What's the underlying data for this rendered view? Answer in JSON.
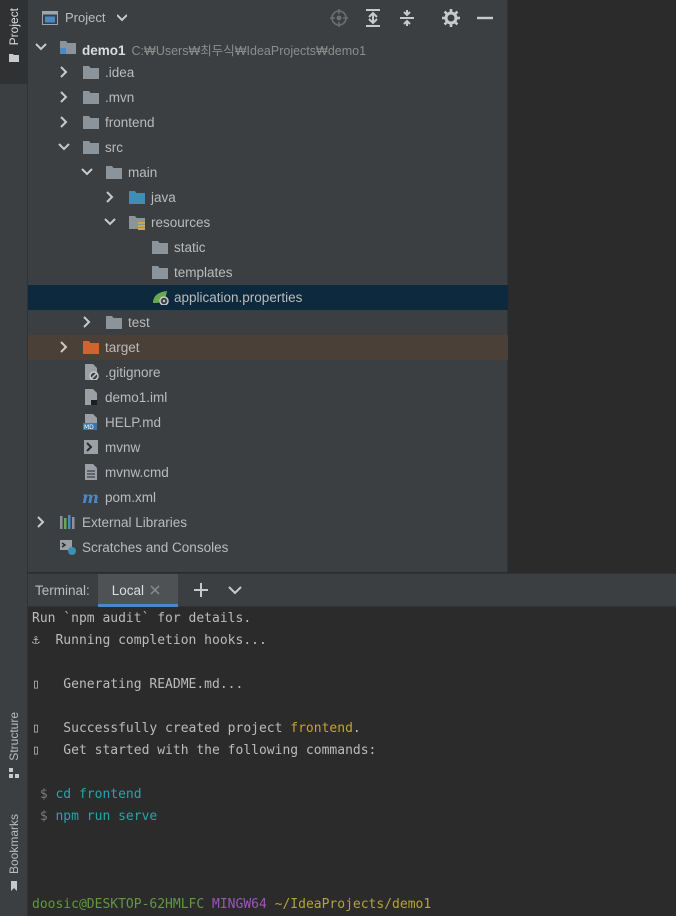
{
  "left_stripe": {
    "project_label": "Project",
    "structure_label": "Structure",
    "bookmarks_label": "Bookmarks"
  },
  "project_panel": {
    "title": "Project",
    "tools": [
      "locate-icon",
      "expand-all-icon",
      "collapse-all-icon",
      "gear-icon",
      "hide-icon"
    ],
    "tree": [
      {
        "label": "demo1",
        "path": "C:₩Users₩최두식₩IdeaProjects₩demo1",
        "depth": 0,
        "arrow": "down",
        "icon": "module-folder",
        "bold": true
      },
      {
        "label": ".idea",
        "depth": 1,
        "arrow": "right",
        "icon": "folder"
      },
      {
        "label": ".mvn",
        "depth": 1,
        "arrow": "right",
        "icon": "folder"
      },
      {
        "label": "frontend",
        "depth": 1,
        "arrow": "right",
        "icon": "folder"
      },
      {
        "label": "src",
        "depth": 1,
        "arrow": "down",
        "icon": "folder"
      },
      {
        "label": "main",
        "depth": 2,
        "arrow": "down",
        "icon": "folder"
      },
      {
        "label": "java",
        "depth": 3,
        "arrow": "right",
        "icon": "source-folder"
      },
      {
        "label": "resources",
        "depth": 3,
        "arrow": "down",
        "icon": "resources-folder"
      },
      {
        "label": "static",
        "depth": 4,
        "arrow": "none",
        "icon": "folder"
      },
      {
        "label": "templates",
        "depth": 4,
        "arrow": "none",
        "icon": "folder"
      },
      {
        "label": "application.properties",
        "depth": 4,
        "arrow": "none",
        "icon": "spring-properties",
        "selected": true
      },
      {
        "label": "test",
        "depth": 2,
        "arrow": "right",
        "icon": "folder"
      },
      {
        "label": "target",
        "depth": 1,
        "arrow": "right",
        "icon": "excluded-folder",
        "excluded": true
      },
      {
        "label": ".gitignore",
        "depth": 1,
        "arrow": "none",
        "icon": "ignore-file"
      },
      {
        "label": "demo1.iml",
        "depth": 1,
        "arrow": "none",
        "icon": "iml-file"
      },
      {
        "label": "HELP.md",
        "depth": 1,
        "arrow": "none",
        "icon": "md-file"
      },
      {
        "label": "mvnw",
        "depth": 1,
        "arrow": "none",
        "icon": "shell-file"
      },
      {
        "label": "mvnw.cmd",
        "depth": 1,
        "arrow": "none",
        "icon": "text-file"
      },
      {
        "label": "pom.xml",
        "depth": 1,
        "arrow": "none",
        "icon": "maven-file"
      },
      {
        "label": "External Libraries",
        "depth": 0,
        "arrow": "right",
        "icon": "libraries"
      },
      {
        "label": "Scratches and Consoles",
        "depth": 0,
        "arrow": "none",
        "icon": "scratches"
      }
    ]
  },
  "terminal": {
    "title": "Terminal:",
    "tab_label": "Local",
    "lines": [
      {
        "segments": [
          {
            "text": "Run `npm audit` for details.",
            "cls": ""
          }
        ]
      },
      {
        "segments": [
          {
            "text": "⚓  Running completion hooks...",
            "cls": ""
          }
        ]
      },
      {
        "segments": []
      },
      {
        "segments": [
          {
            "text": "▯   Generating README.md...",
            "cls": ""
          }
        ]
      },
      {
        "segments": []
      },
      {
        "segments": [
          {
            "text": "▯   Successfully created project ",
            "cls": ""
          },
          {
            "text": "frontend",
            "cls": "c-yellow"
          },
          {
            "text": ".",
            "cls": ""
          }
        ]
      },
      {
        "segments": [
          {
            "text": "▯   Get started with the following commands:",
            "cls": ""
          }
        ]
      },
      {
        "segments": []
      },
      {
        "segments": [
          {
            "text": " $ ",
            "cls": "c-dim"
          },
          {
            "text": "cd frontend",
            "cls": "c-cyan"
          }
        ]
      },
      {
        "segments": [
          {
            "text": " $ ",
            "cls": "c-dim"
          },
          {
            "text": "npm run serve",
            "cls": "c-cyan"
          }
        ]
      },
      {
        "segments": []
      },
      {
        "segments": []
      },
      {
        "segments": []
      },
      {
        "segments": [
          {
            "text": "doosic@DESKTOP-62HMLFC",
            "cls": "c-green"
          },
          {
            "text": " ",
            "cls": ""
          },
          {
            "text": "MINGW64",
            "cls": "c-magenta"
          },
          {
            "text": " ",
            "cls": ""
          },
          {
            "text": "~/IdeaProjects/demo1",
            "cls": "c-gold"
          }
        ]
      },
      {
        "segments": [
          {
            "text": "$",
            "cls": ""
          }
        ],
        "cursor": true
      }
    ]
  }
}
